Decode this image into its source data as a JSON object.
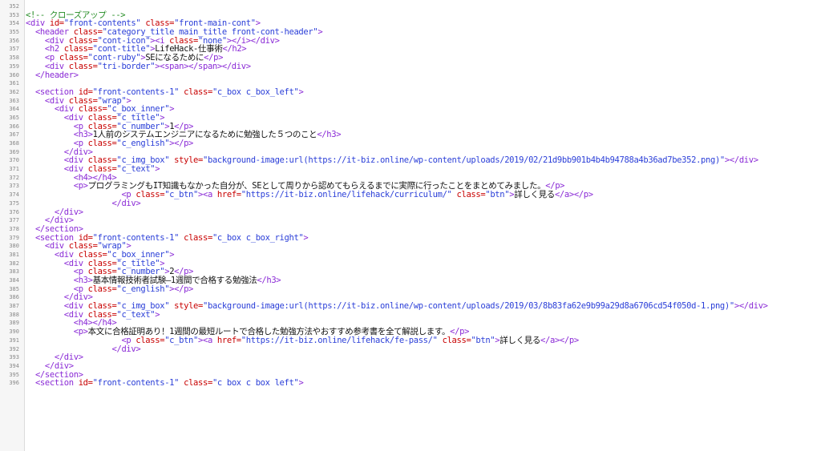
{
  "editor": {
    "lines": [
      {
        "n": "352",
        "indent": "",
        "parts": []
      },
      {
        "n": "353",
        "indent": "",
        "parts": [
          {
            "k": "c",
            "s": "<!-- クローズアップ -->"
          }
        ]
      },
      {
        "n": "354",
        "indent": "",
        "parts": [
          {
            "k": "t",
            "s": "<div "
          },
          {
            "k": "a",
            "s": "id="
          },
          {
            "k": "v",
            "s": "\"front-contents\""
          },
          {
            "k": "x",
            "s": " "
          },
          {
            "k": "a",
            "s": "class="
          },
          {
            "k": "v",
            "s": "\"front-main-cont\""
          },
          {
            "k": "t",
            "s": ">"
          }
        ]
      },
      {
        "n": "355",
        "indent": "  ",
        "parts": [
          {
            "k": "t",
            "s": "<header "
          },
          {
            "k": "a",
            "s": "class="
          },
          {
            "k": "v",
            "s": "\"category_title main_title front-cont-header\""
          },
          {
            "k": "t",
            "s": ">"
          }
        ]
      },
      {
        "n": "356",
        "indent": "    ",
        "parts": [
          {
            "k": "t",
            "s": "<div "
          },
          {
            "k": "a",
            "s": "class="
          },
          {
            "k": "v",
            "s": "\"cont-icon\""
          },
          {
            "k": "t",
            "s": "><i "
          },
          {
            "k": "a",
            "s": "class="
          },
          {
            "k": "v",
            "s": "\"none\""
          },
          {
            "k": "t",
            "s": "></i></div>"
          }
        ]
      },
      {
        "n": "357",
        "indent": "    ",
        "parts": [
          {
            "k": "t",
            "s": "<h2 "
          },
          {
            "k": "a",
            "s": "class="
          },
          {
            "k": "v",
            "s": "\"cont-title\""
          },
          {
            "k": "t",
            "s": ">"
          },
          {
            "k": "x",
            "s": "LifeHack-仕事術"
          },
          {
            "k": "t",
            "s": "</h2>"
          }
        ]
      },
      {
        "n": "358",
        "indent": "    ",
        "parts": [
          {
            "k": "t",
            "s": "<p "
          },
          {
            "k": "a",
            "s": "class="
          },
          {
            "k": "v",
            "s": "\"cont-ruby\""
          },
          {
            "k": "t",
            "s": ">"
          },
          {
            "k": "x",
            "s": "SEになるために"
          },
          {
            "k": "t",
            "s": "</p>"
          }
        ]
      },
      {
        "n": "359",
        "indent": "    ",
        "parts": [
          {
            "k": "t",
            "s": "<div "
          },
          {
            "k": "a",
            "s": "class="
          },
          {
            "k": "v",
            "s": "\"tri-border\""
          },
          {
            "k": "t",
            "s": "><span></span></div>"
          }
        ]
      },
      {
        "n": "360",
        "indent": "  ",
        "parts": [
          {
            "k": "t",
            "s": "</header>"
          }
        ]
      },
      {
        "n": "361",
        "indent": "",
        "parts": []
      },
      {
        "n": "362",
        "indent": "  ",
        "parts": [
          {
            "k": "t",
            "s": "<section "
          },
          {
            "k": "a",
            "s": "id="
          },
          {
            "k": "v",
            "s": "\"front-contents-1\""
          },
          {
            "k": "x",
            "s": " "
          },
          {
            "k": "a",
            "s": "class="
          },
          {
            "k": "v",
            "s": "\"c_box c_box_left\""
          },
          {
            "k": "t",
            "s": ">"
          }
        ]
      },
      {
        "n": "363",
        "indent": "    ",
        "parts": [
          {
            "k": "t",
            "s": "<div "
          },
          {
            "k": "a",
            "s": "class="
          },
          {
            "k": "v",
            "s": "\"wrap\""
          },
          {
            "k": "t",
            "s": ">"
          }
        ]
      },
      {
        "n": "364",
        "indent": "      ",
        "parts": [
          {
            "k": "t",
            "s": "<div "
          },
          {
            "k": "a",
            "s": "class="
          },
          {
            "k": "v",
            "s": "\"c_box_inner\""
          },
          {
            "k": "t",
            "s": ">"
          }
        ]
      },
      {
        "n": "365",
        "indent": "        ",
        "parts": [
          {
            "k": "t",
            "s": "<div "
          },
          {
            "k": "a",
            "s": "class="
          },
          {
            "k": "v",
            "s": "\"c_title\""
          },
          {
            "k": "t",
            "s": ">"
          }
        ]
      },
      {
        "n": "366",
        "indent": "          ",
        "parts": [
          {
            "k": "t",
            "s": "<p "
          },
          {
            "k": "a",
            "s": "class="
          },
          {
            "k": "v",
            "s": "\"c_number\""
          },
          {
            "k": "t",
            "s": ">"
          },
          {
            "k": "x",
            "s": "1"
          },
          {
            "k": "t",
            "s": "</p>"
          }
        ]
      },
      {
        "n": "367",
        "indent": "          ",
        "parts": [
          {
            "k": "t",
            "s": "<h3>"
          },
          {
            "k": "x",
            "s": "1人前のシステムエンジニアになるために勉強した５つのこと"
          },
          {
            "k": "t",
            "s": "</h3>"
          }
        ]
      },
      {
        "n": "368",
        "indent": "          ",
        "parts": [
          {
            "k": "t",
            "s": "<p "
          },
          {
            "k": "a",
            "s": "class="
          },
          {
            "k": "v",
            "s": "\"c_english\""
          },
          {
            "k": "t",
            "s": "></p>"
          }
        ]
      },
      {
        "n": "369",
        "indent": "        ",
        "parts": [
          {
            "k": "t",
            "s": "</div>"
          }
        ]
      },
      {
        "n": "370",
        "indent": "        ",
        "parts": [
          {
            "k": "t",
            "s": "<div "
          },
          {
            "k": "a",
            "s": "class="
          },
          {
            "k": "v",
            "s": "\"c_img_box\""
          },
          {
            "k": "x",
            "s": " "
          },
          {
            "k": "a",
            "s": "style="
          },
          {
            "k": "v",
            "s": "\"background-image:url(https://it-biz.online/wp-content/uploads/2019/02/21d9bb901b4b4b94788a4b36ad7be352.png)\""
          },
          {
            "k": "t",
            "s": "></div>"
          }
        ]
      },
      {
        "n": "371",
        "indent": "        ",
        "parts": [
          {
            "k": "t",
            "s": "<div "
          },
          {
            "k": "a",
            "s": "class="
          },
          {
            "k": "v",
            "s": "\"c_text\""
          },
          {
            "k": "t",
            "s": ">"
          }
        ]
      },
      {
        "n": "372",
        "indent": "          ",
        "parts": [
          {
            "k": "t",
            "s": "<h4></h4>"
          }
        ]
      },
      {
        "n": "373",
        "indent": "          ",
        "parts": [
          {
            "k": "t",
            "s": "<p>"
          },
          {
            "k": "x",
            "s": "プログラミングもIT知識もなかった自分が、SEとして周りから認めてもらえるまでに実際に行ったことをまとめてみました。"
          },
          {
            "k": "t",
            "s": "</p>"
          }
        ]
      },
      {
        "n": "374",
        "indent": "                    ",
        "parts": [
          {
            "k": "t",
            "s": "<p "
          },
          {
            "k": "a",
            "s": "class="
          },
          {
            "k": "v",
            "s": "\"c_btn\""
          },
          {
            "k": "t",
            "s": "><a "
          },
          {
            "k": "a",
            "s": "href="
          },
          {
            "k": "v",
            "s": "\"https://it-biz.online/lifehack/curriculum/\""
          },
          {
            "k": "x",
            "s": " "
          },
          {
            "k": "a",
            "s": "class="
          },
          {
            "k": "v",
            "s": "\"btn\""
          },
          {
            "k": "t",
            "s": ">"
          },
          {
            "k": "x",
            "s": "詳しく見る"
          },
          {
            "k": "t",
            "s": "</a></p>"
          }
        ]
      },
      {
        "n": "375",
        "indent": "                  ",
        "parts": [
          {
            "k": "t",
            "s": "</div>"
          }
        ]
      },
      {
        "n": "376",
        "indent": "      ",
        "parts": [
          {
            "k": "t",
            "s": "</div>"
          }
        ]
      },
      {
        "n": "377",
        "indent": "    ",
        "parts": [
          {
            "k": "t",
            "s": "</div>"
          }
        ]
      },
      {
        "n": "378",
        "indent": "  ",
        "parts": [
          {
            "k": "t",
            "s": "</section>"
          }
        ]
      },
      {
        "n": "379",
        "indent": "  ",
        "parts": [
          {
            "k": "t",
            "s": "<section "
          },
          {
            "k": "a",
            "s": "id="
          },
          {
            "k": "v",
            "s": "\"front-contents-1\""
          },
          {
            "k": "x",
            "s": " "
          },
          {
            "k": "a",
            "s": "class="
          },
          {
            "k": "v",
            "s": "\"c_box c_box_right\""
          },
          {
            "k": "t",
            "s": ">"
          }
        ]
      },
      {
        "n": "380",
        "indent": "    ",
        "parts": [
          {
            "k": "t",
            "s": "<div "
          },
          {
            "k": "a",
            "s": "class="
          },
          {
            "k": "v",
            "s": "\"wrap\""
          },
          {
            "k": "t",
            "s": ">"
          }
        ]
      },
      {
        "n": "381",
        "indent": "      ",
        "parts": [
          {
            "k": "t",
            "s": "<div "
          },
          {
            "k": "a",
            "s": "class="
          },
          {
            "k": "v",
            "s": "\"c_box_inner\""
          },
          {
            "k": "t",
            "s": ">"
          }
        ]
      },
      {
        "n": "382",
        "indent": "        ",
        "parts": [
          {
            "k": "t",
            "s": "<div "
          },
          {
            "k": "a",
            "s": "class="
          },
          {
            "k": "v",
            "s": "\"c_title\""
          },
          {
            "k": "t",
            "s": ">"
          }
        ]
      },
      {
        "n": "383",
        "indent": "          ",
        "parts": [
          {
            "k": "t",
            "s": "<p "
          },
          {
            "k": "a",
            "s": "class="
          },
          {
            "k": "v",
            "s": "\"c_number\""
          },
          {
            "k": "t",
            "s": ">"
          },
          {
            "k": "x",
            "s": "2"
          },
          {
            "k": "t",
            "s": "</p>"
          }
        ]
      },
      {
        "n": "384",
        "indent": "          ",
        "parts": [
          {
            "k": "t",
            "s": "<h3>"
          },
          {
            "k": "x",
            "s": "基本情報技術者試験―1週間で合格する勉強法"
          },
          {
            "k": "t",
            "s": "</h3>"
          }
        ]
      },
      {
        "n": "385",
        "indent": "          ",
        "parts": [
          {
            "k": "t",
            "s": "<p "
          },
          {
            "k": "a",
            "s": "class="
          },
          {
            "k": "v",
            "s": "\"c_english\""
          },
          {
            "k": "t",
            "s": "></p>"
          }
        ]
      },
      {
        "n": "386",
        "indent": "        ",
        "parts": [
          {
            "k": "t",
            "s": "</div>"
          }
        ]
      },
      {
        "n": "387",
        "indent": "        ",
        "parts": [
          {
            "k": "t",
            "s": "<div "
          },
          {
            "k": "a",
            "s": "class="
          },
          {
            "k": "v",
            "s": "\"c_img_box\""
          },
          {
            "k": "x",
            "s": " "
          },
          {
            "k": "a",
            "s": "style="
          },
          {
            "k": "v",
            "s": "\"background-image:url(https://it-biz.online/wp-content/uploads/2019/03/8b83fa62e9b99a29d8a6706cd54f050d-1.png)\""
          },
          {
            "k": "t",
            "s": "></div>"
          }
        ]
      },
      {
        "n": "388",
        "indent": "        ",
        "parts": [
          {
            "k": "t",
            "s": "<div "
          },
          {
            "k": "a",
            "s": "class="
          },
          {
            "k": "v",
            "s": "\"c_text\""
          },
          {
            "k": "t",
            "s": ">"
          }
        ]
      },
      {
        "n": "389",
        "indent": "          ",
        "parts": [
          {
            "k": "t",
            "s": "<h4></h4>"
          }
        ]
      },
      {
        "n": "390",
        "indent": "          ",
        "parts": [
          {
            "k": "t",
            "s": "<p>"
          },
          {
            "k": "x",
            "s": "本文に合格証明あり！1週間の最短ルートで合格した勉強方法やおすすめ参考書を全て解説します。"
          },
          {
            "k": "t",
            "s": "</p>"
          }
        ]
      },
      {
        "n": "391",
        "indent": "                    ",
        "parts": [
          {
            "k": "t",
            "s": "<p "
          },
          {
            "k": "a",
            "s": "class="
          },
          {
            "k": "v",
            "s": "\"c_btn\""
          },
          {
            "k": "t",
            "s": "><a "
          },
          {
            "k": "a",
            "s": "href="
          },
          {
            "k": "v",
            "s": "\"https://it-biz.online/lifehack/fe-pass/\""
          },
          {
            "k": "x",
            "s": " "
          },
          {
            "k": "a",
            "s": "class="
          },
          {
            "k": "v",
            "s": "\"btn\""
          },
          {
            "k": "t",
            "s": ">"
          },
          {
            "k": "x",
            "s": "詳しく見る"
          },
          {
            "k": "t",
            "s": "</a></p>"
          }
        ]
      },
      {
        "n": "392",
        "indent": "                  ",
        "parts": [
          {
            "k": "t",
            "s": "</div>"
          }
        ]
      },
      {
        "n": "393",
        "indent": "      ",
        "parts": [
          {
            "k": "t",
            "s": "</div>"
          }
        ]
      },
      {
        "n": "394",
        "indent": "    ",
        "parts": [
          {
            "k": "t",
            "s": "</div>"
          }
        ]
      },
      {
        "n": "395",
        "indent": "  ",
        "parts": [
          {
            "k": "t",
            "s": "</section>"
          }
        ]
      },
      {
        "n": "396",
        "indent": "  ",
        "parts": [
          {
            "k": "t",
            "s": "<section "
          },
          {
            "k": "a",
            "s": "id="
          },
          {
            "k": "v",
            "s": "\"front-contents-1\""
          },
          {
            "k": "x",
            "s": " "
          },
          {
            "k": "a",
            "s": "class="
          },
          {
            "k": "v",
            "s": "\"c box c box left\""
          },
          {
            "k": "t",
            "s": ">"
          }
        ]
      }
    ]
  }
}
